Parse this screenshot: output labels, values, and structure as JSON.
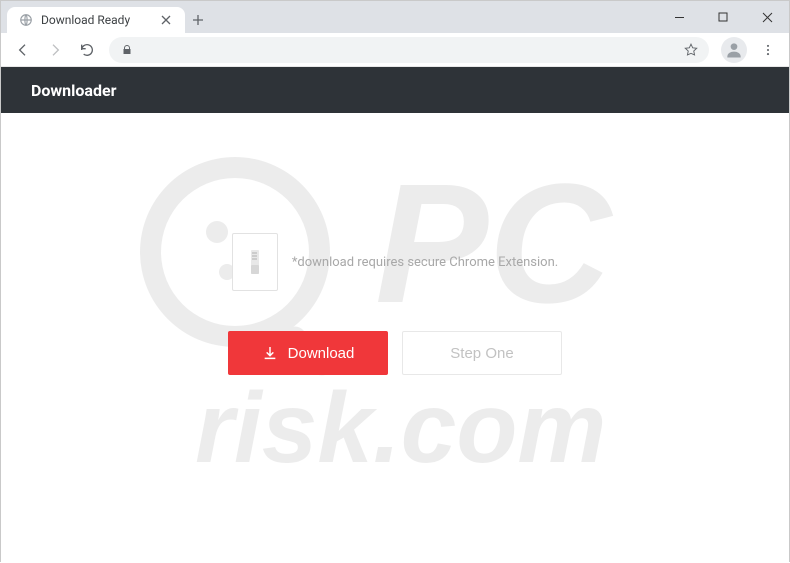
{
  "browser": {
    "tab_title": "Download Ready"
  },
  "page": {
    "header": "Downloader",
    "info_text": "*download requires secure Chrome Extension.",
    "download_label": "Download",
    "step_label": "Step One"
  },
  "watermark": {
    "top_text": "PC",
    "bottom_text": "risk.com"
  }
}
